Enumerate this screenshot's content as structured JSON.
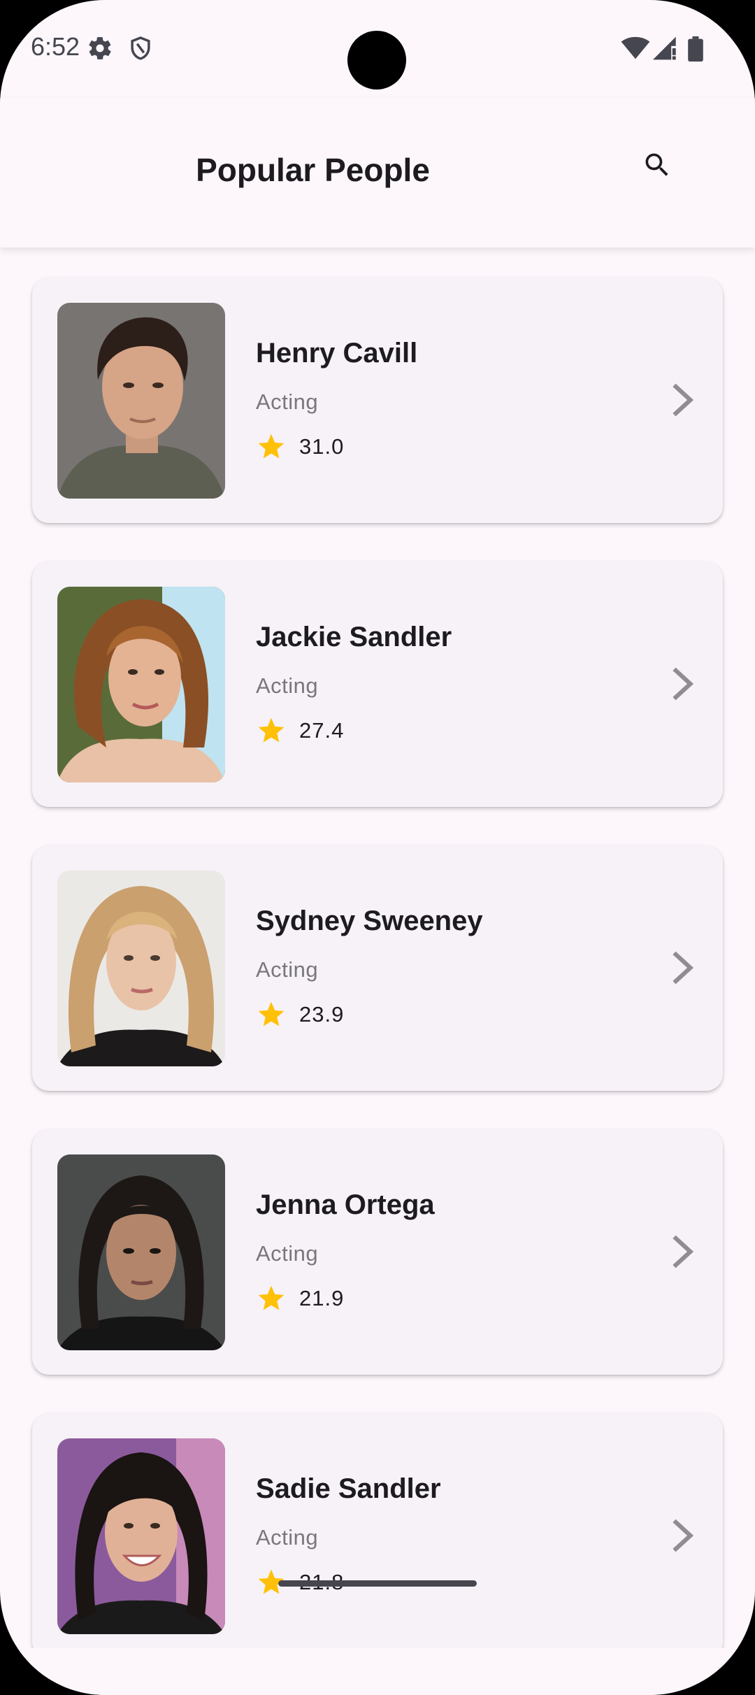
{
  "status_bar": {
    "time": "6:52",
    "icons": [
      "settings-icon",
      "shield-icon",
      "wifi-icon",
      "signal-icon",
      "battery-icon"
    ]
  },
  "app_bar": {
    "title": "Popular People",
    "search_icon": "search-icon"
  },
  "people": [
    {
      "name": "Henry Cavill",
      "department": "Acting",
      "popularity": "31.0"
    },
    {
      "name": "Jackie Sandler",
      "department": "Acting",
      "popularity": "27.4"
    },
    {
      "name": "Sydney Sweeney",
      "department": "Acting",
      "popularity": "23.9"
    },
    {
      "name": "Jenna Ortega",
      "department": "Acting",
      "popularity": "21.9"
    },
    {
      "name": "Sadie Sandler",
      "department": "Acting",
      "popularity": "21.8"
    }
  ],
  "colors": {
    "background": "#fdf7fc",
    "card": "#f6f2f8",
    "star": "#ffc107",
    "text_primary": "#1d1b20",
    "text_secondary": "#79767d"
  }
}
